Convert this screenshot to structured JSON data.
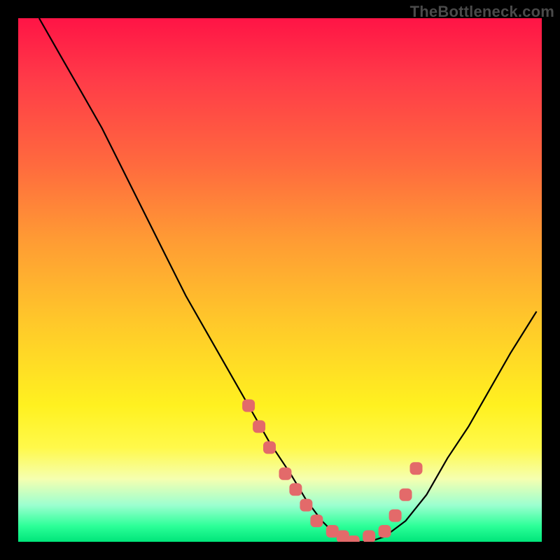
{
  "watermark": "TheBottleneck.com",
  "chart_data": {
    "type": "line",
    "title": "",
    "xlabel": "",
    "ylabel": "",
    "xlim": [
      0,
      100
    ],
    "ylim": [
      0,
      100
    ],
    "series": [
      {
        "name": "bottleneck-curve",
        "x": [
          4,
          8,
          12,
          16,
          20,
          24,
          28,
          32,
          36,
          40,
          44,
          48,
          52,
          55,
          58,
          61,
          64,
          67,
          70,
          74,
          78,
          82,
          86,
          90,
          94,
          99
        ],
        "y": [
          100,
          93,
          86,
          79,
          71,
          63,
          55,
          47,
          40,
          33,
          26,
          19,
          13,
          8,
          4,
          1,
          0,
          0,
          1,
          4,
          9,
          16,
          22,
          29,
          36,
          44
        ]
      }
    ],
    "markers": {
      "name": "highlight-dots",
      "x": [
        44,
        46,
        48,
        51,
        53,
        55,
        57,
        60,
        62,
        64,
        67,
        70,
        72,
        74,
        76
      ],
      "y": [
        26,
        22,
        18,
        13,
        10,
        7,
        4,
        2,
        1,
        0,
        1,
        2,
        5,
        9,
        14
      ]
    }
  }
}
